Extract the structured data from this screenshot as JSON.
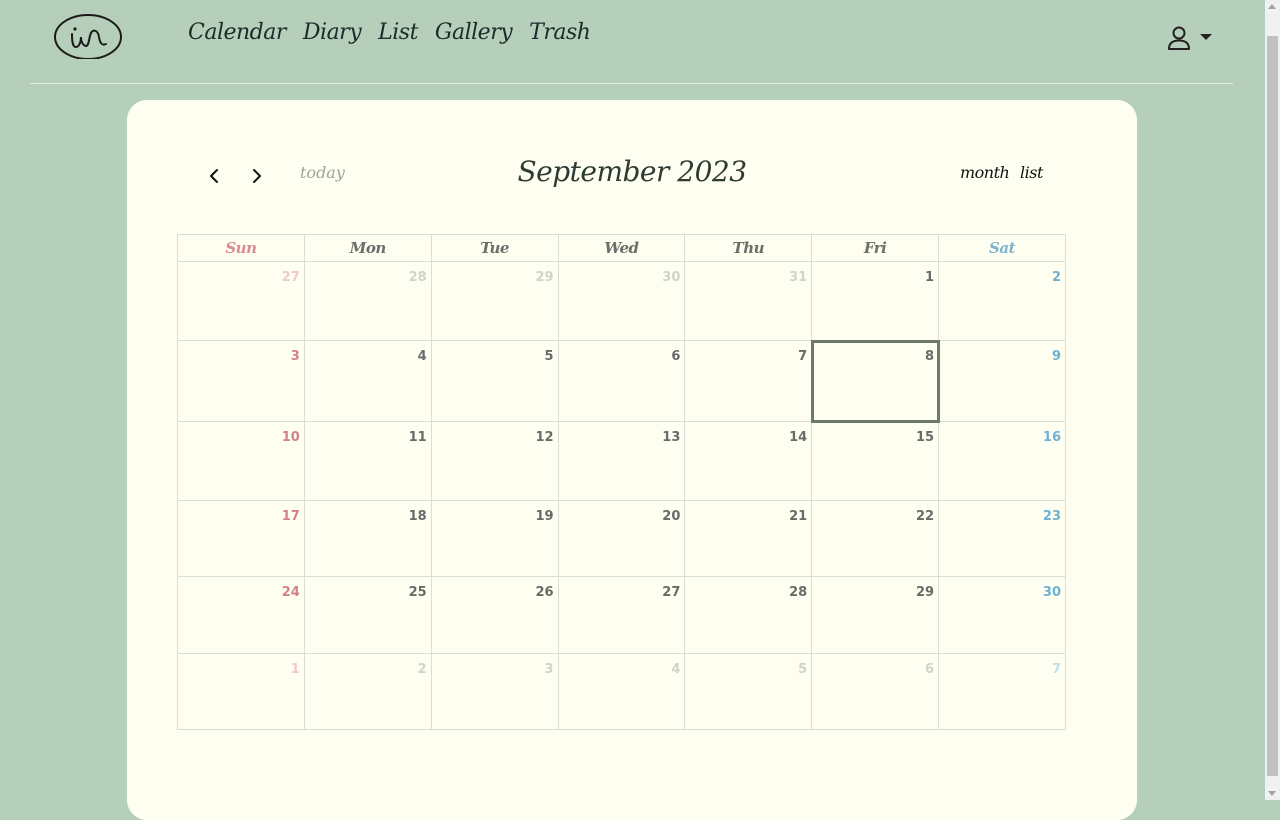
{
  "nav": {
    "items": [
      {
        "label": "Calendar"
      },
      {
        "label": "Diary"
      },
      {
        "label": "List"
      },
      {
        "label": "Gallery"
      },
      {
        "label": "Trash"
      }
    ]
  },
  "toolbar": {
    "title": "September 2023",
    "today_label": "today",
    "month_label": "month",
    "list_label": "list"
  },
  "calendar": {
    "weekdays": [
      "Sun",
      "Mon",
      "Tue",
      "Wed",
      "Thu",
      "Fri",
      "Sat"
    ],
    "today": "8",
    "weeks": [
      [
        "27",
        "28",
        "29",
        "30",
        "31",
        "1",
        "2"
      ],
      [
        "3",
        "4",
        "5",
        "6",
        "7",
        "8",
        "9"
      ],
      [
        "10",
        "11",
        "12",
        "13",
        "14",
        "15",
        "16"
      ],
      [
        "17",
        "18",
        "19",
        "20",
        "21",
        "22",
        "23"
      ],
      [
        "24",
        "25",
        "26",
        "27",
        "28",
        "29",
        "30"
      ],
      [
        "1",
        "2",
        "3",
        "4",
        "5",
        "6",
        "7"
      ]
    ]
  },
  "colors": {
    "background": "#b6cfba",
    "card": "#fefff0",
    "sunday": "#d37f8d",
    "saturday": "#6fb0d3",
    "today_outline": "#6e7a6c"
  },
  "icons": {
    "logo": "in-logo",
    "user": "user-icon",
    "dropdown": "caret-down-icon",
    "prev": "chevron-left-icon",
    "next": "chevron-right-icon"
  }
}
